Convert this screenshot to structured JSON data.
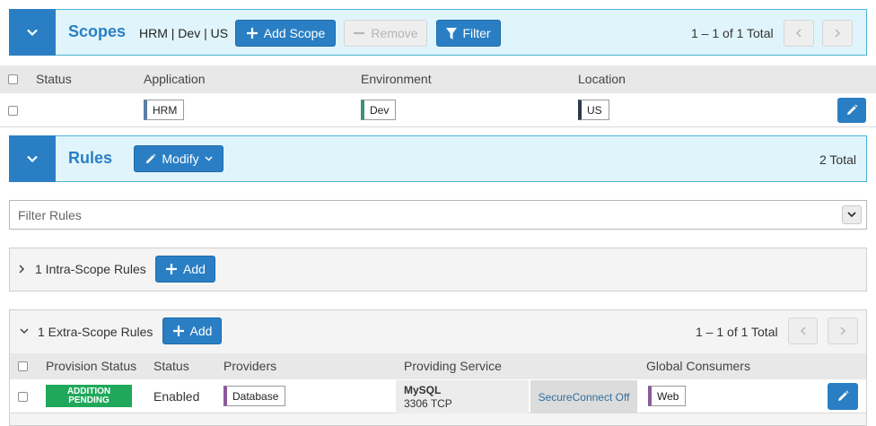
{
  "scopes": {
    "title": "Scopes",
    "scope_label": "HRM | Dev | US",
    "add_label": "Add Scope",
    "remove_label": "Remove",
    "filter_label": "Filter",
    "pagination": "1 – 1 of 1 Total",
    "columns": [
      "Status",
      "Application",
      "Environment",
      "Location"
    ],
    "rows": [
      {
        "application": "HRM",
        "environment": "Dev",
        "location": "US"
      }
    ],
    "tag_colors": {
      "application": "#5a7fa3",
      "environment": "#3f8f7a",
      "location": "#2b3a4a"
    }
  },
  "rules": {
    "title": "Rules",
    "modify_label": "Modify",
    "total": "2 Total",
    "filter_placeholder": "Filter Rules",
    "intra": {
      "label": "1 Intra-Scope Rules",
      "add_label": "Add"
    },
    "extra": {
      "label": "1 Extra-Scope Rules",
      "add_label": "Add",
      "pagination": "1 – 1 of 1 Total",
      "columns": [
        "Provision Status",
        "Status",
        "Providers",
        "Providing Service",
        "Global Consumers"
      ],
      "rows": [
        {
          "provision_status": "ADDITION PENDING",
          "status": "Enabled",
          "provider": "Database",
          "service_name": "MySQL",
          "service_port": "3306 TCP",
          "secure_connect": "SecureConnect Off",
          "consumer": "Web"
        }
      ]
    }
  },
  "colors": {
    "accent": "#2a7fc4",
    "header_bg": "#e0f5fb",
    "header_border": "#4bb4d6",
    "badge_green": "#1fa85a",
    "role_tag": "#8a5a9a"
  }
}
